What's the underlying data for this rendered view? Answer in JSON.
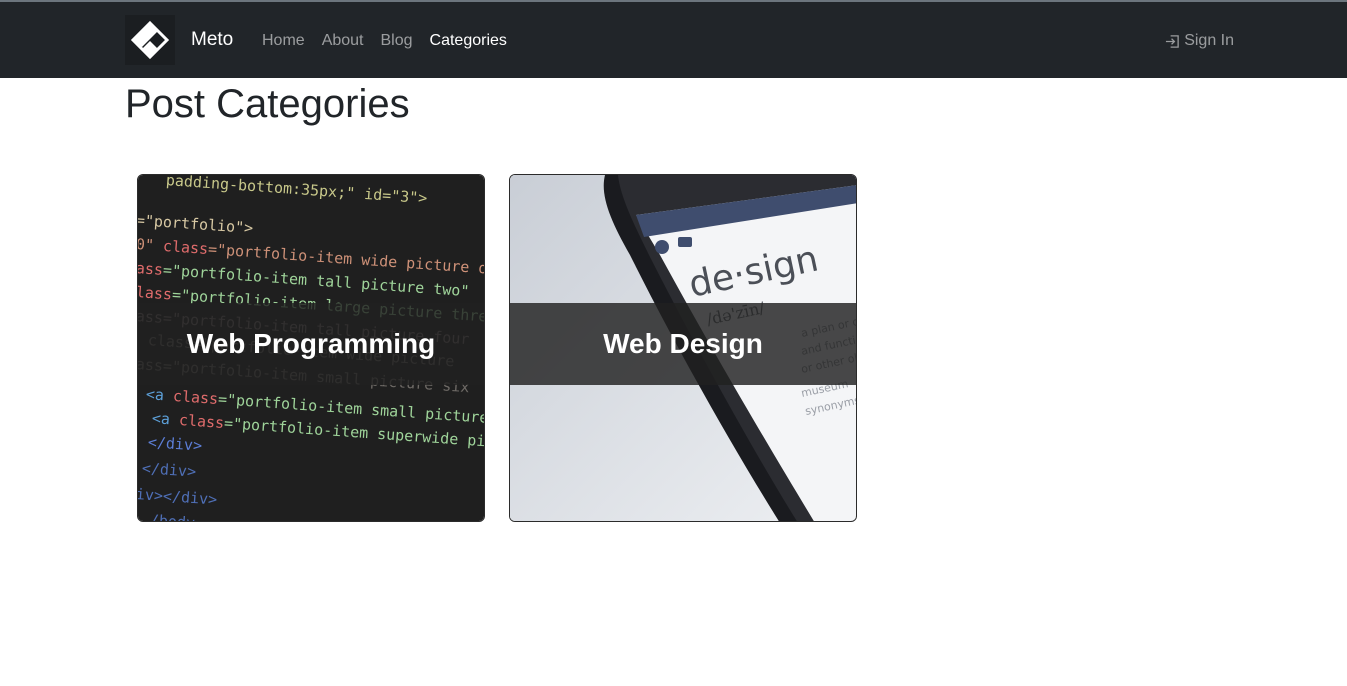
{
  "navbar": {
    "brand": "Meto",
    "links": [
      {
        "label": "Home",
        "active": false
      },
      {
        "label": "About",
        "active": false
      },
      {
        "label": "Blog",
        "active": false
      },
      {
        "label": "Categories",
        "active": true
      }
    ],
    "signin_label": "Sign In"
  },
  "page": {
    "title": "Post Categories"
  },
  "categories": [
    {
      "title": "Web Programming",
      "image": "code-editor-photo"
    },
    {
      "title": "Web Design",
      "image": "phone-design-photo"
    }
  ],
  "colors": {
    "navbar_bg": "#212529",
    "nav_active": "#ffffff",
    "nav_inactive": "rgba(255,255,255,0.55)",
    "card_band": "rgba(33,33,33,0.82)"
  }
}
